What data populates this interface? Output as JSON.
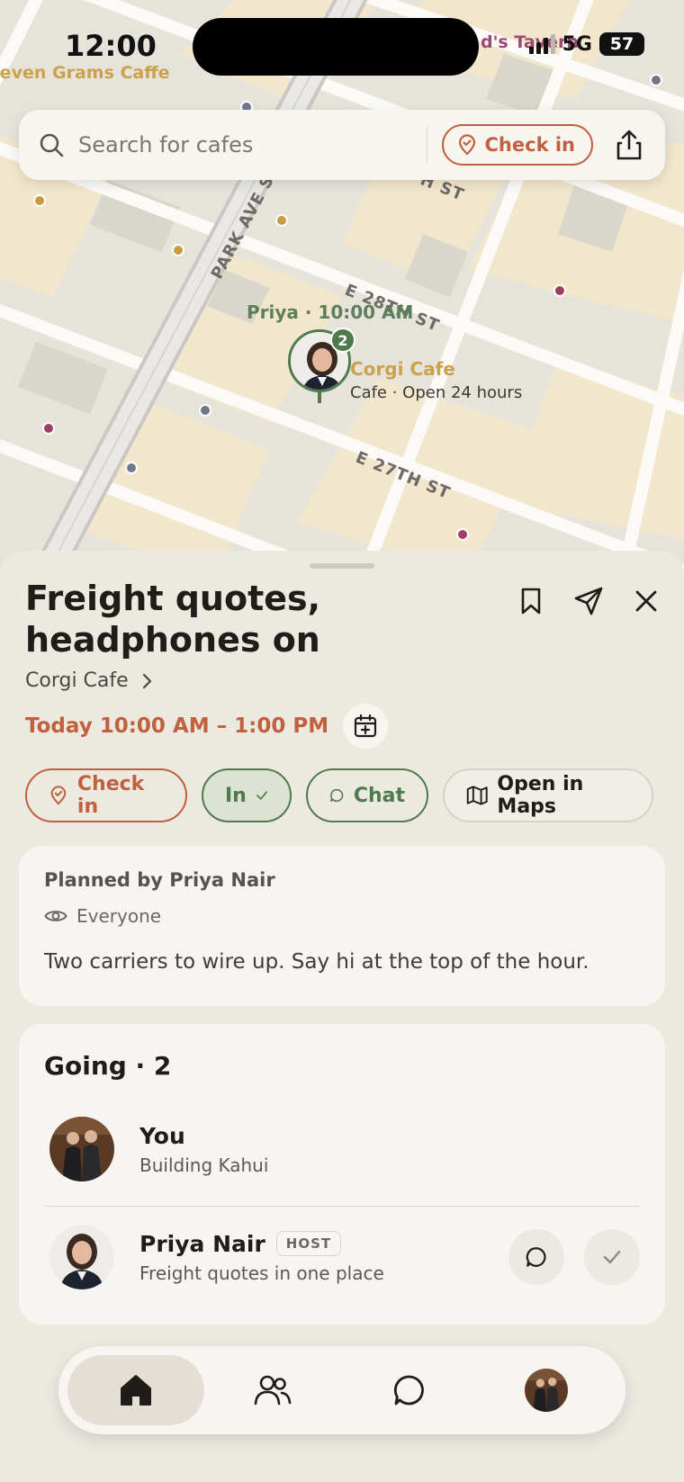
{
  "status_bar": {
    "time": "12:00",
    "network": "5G",
    "battery": "57"
  },
  "map": {
    "street_labels": [
      "PARK AVE S",
      "E 28TH ST",
      "E 27TH ST",
      "H ST"
    ],
    "poi_labels": [
      "Seven Grams Caffe",
      "d's Tavern"
    ],
    "marker_label": "Priya · 10:00 AM",
    "marker_count": "2",
    "cafe_name": "Corgi Cafe",
    "cafe_meta": "Cafe · Open 24 hours"
  },
  "search": {
    "placeholder": "Search for cafes",
    "checkin_label": "Check in"
  },
  "event": {
    "title": "Freight quotes, headphones on",
    "venue": "Corgi Cafe",
    "time_range": "Today 10:00 AM – 1:00 PM"
  },
  "actions": {
    "checkin": "Check in",
    "in": "In",
    "chat": "Chat",
    "maps": "Open in Maps"
  },
  "plan": {
    "planned_by": "Planned by Priya Nair",
    "visibility": "Everyone",
    "description": "Two carriers to wire up. Say hi at the top of the hour."
  },
  "going": {
    "title": "Going · 2",
    "people": [
      {
        "name": "You",
        "status": "Building Kahui"
      },
      {
        "name": "Priya Nair",
        "badge": "HOST",
        "status": "Freight quotes in one place"
      }
    ]
  },
  "colors": {
    "accent": "#C0603F",
    "green": "#4E7A4C",
    "gold": "#C9A24B",
    "background": "#ECE9E1"
  },
  "tabs": [
    "home-icon",
    "friends-icon",
    "chat-icon",
    "profile-avatar"
  ]
}
